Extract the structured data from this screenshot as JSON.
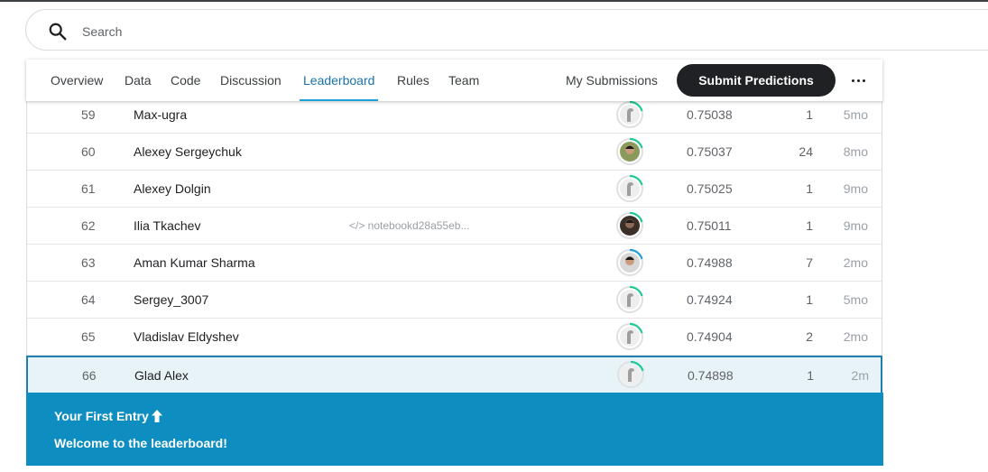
{
  "search": {
    "placeholder": "Search"
  },
  "tabs": [
    {
      "label": "Overview"
    },
    {
      "label": "Data"
    },
    {
      "label": "Code"
    },
    {
      "label": "Discussion"
    },
    {
      "label": "Leaderboard"
    },
    {
      "label": "Rules"
    },
    {
      "label": "Team"
    }
  ],
  "active_tab": "Leaderboard",
  "my_submissions_label": "My Submissions",
  "submit_label": "Submit Predictions",
  "more_icon": "more-horiz-icon",
  "rows": [
    {
      "rank": "59",
      "name": "Max-ugra",
      "notebook": "",
      "score": "0.75038",
      "entries": "1",
      "last": "5mo",
      "avatar": "default"
    },
    {
      "rank": "60",
      "name": "Alexey Sergeychuk",
      "notebook": "",
      "score": "0.75037",
      "entries": "24",
      "last": "8mo",
      "avatar": "photo"
    },
    {
      "rank": "61",
      "name": "Alexey Dolgin",
      "notebook": "",
      "score": "0.75025",
      "entries": "1",
      "last": "9mo",
      "avatar": "default"
    },
    {
      "rank": "62",
      "name": "Ilia Tkachev",
      "notebook": "notebookd28a55eb...",
      "score": "0.75011",
      "entries": "1",
      "last": "9mo",
      "avatar": "photo"
    },
    {
      "rank": "63",
      "name": "Aman Kumar Sharma",
      "notebook": "",
      "score": "0.74988",
      "entries": "7",
      "last": "2mo",
      "avatar": "photo"
    },
    {
      "rank": "64",
      "name": "Sergey_3007",
      "notebook": "",
      "score": "0.74924",
      "entries": "1",
      "last": "5mo",
      "avatar": "default"
    },
    {
      "rank": "65",
      "name": "Vladislav Eldyshev",
      "notebook": "",
      "score": "0.74904",
      "entries": "2",
      "last": "2mo",
      "avatar": "default"
    },
    {
      "rank": "66",
      "name": "Glad Alex",
      "notebook": "",
      "score": "0.74898",
      "entries": "1",
      "last": "2m",
      "avatar": "default",
      "highlight": true
    }
  ],
  "banner": {
    "title": "Your First Entry",
    "message": "Welcome to the leaderboard!"
  },
  "colors": {
    "accent": "#20a0d8",
    "banner": "#0e8dc0",
    "highlight_row": "#e8f3f8",
    "progress_ring": "#20c997"
  }
}
